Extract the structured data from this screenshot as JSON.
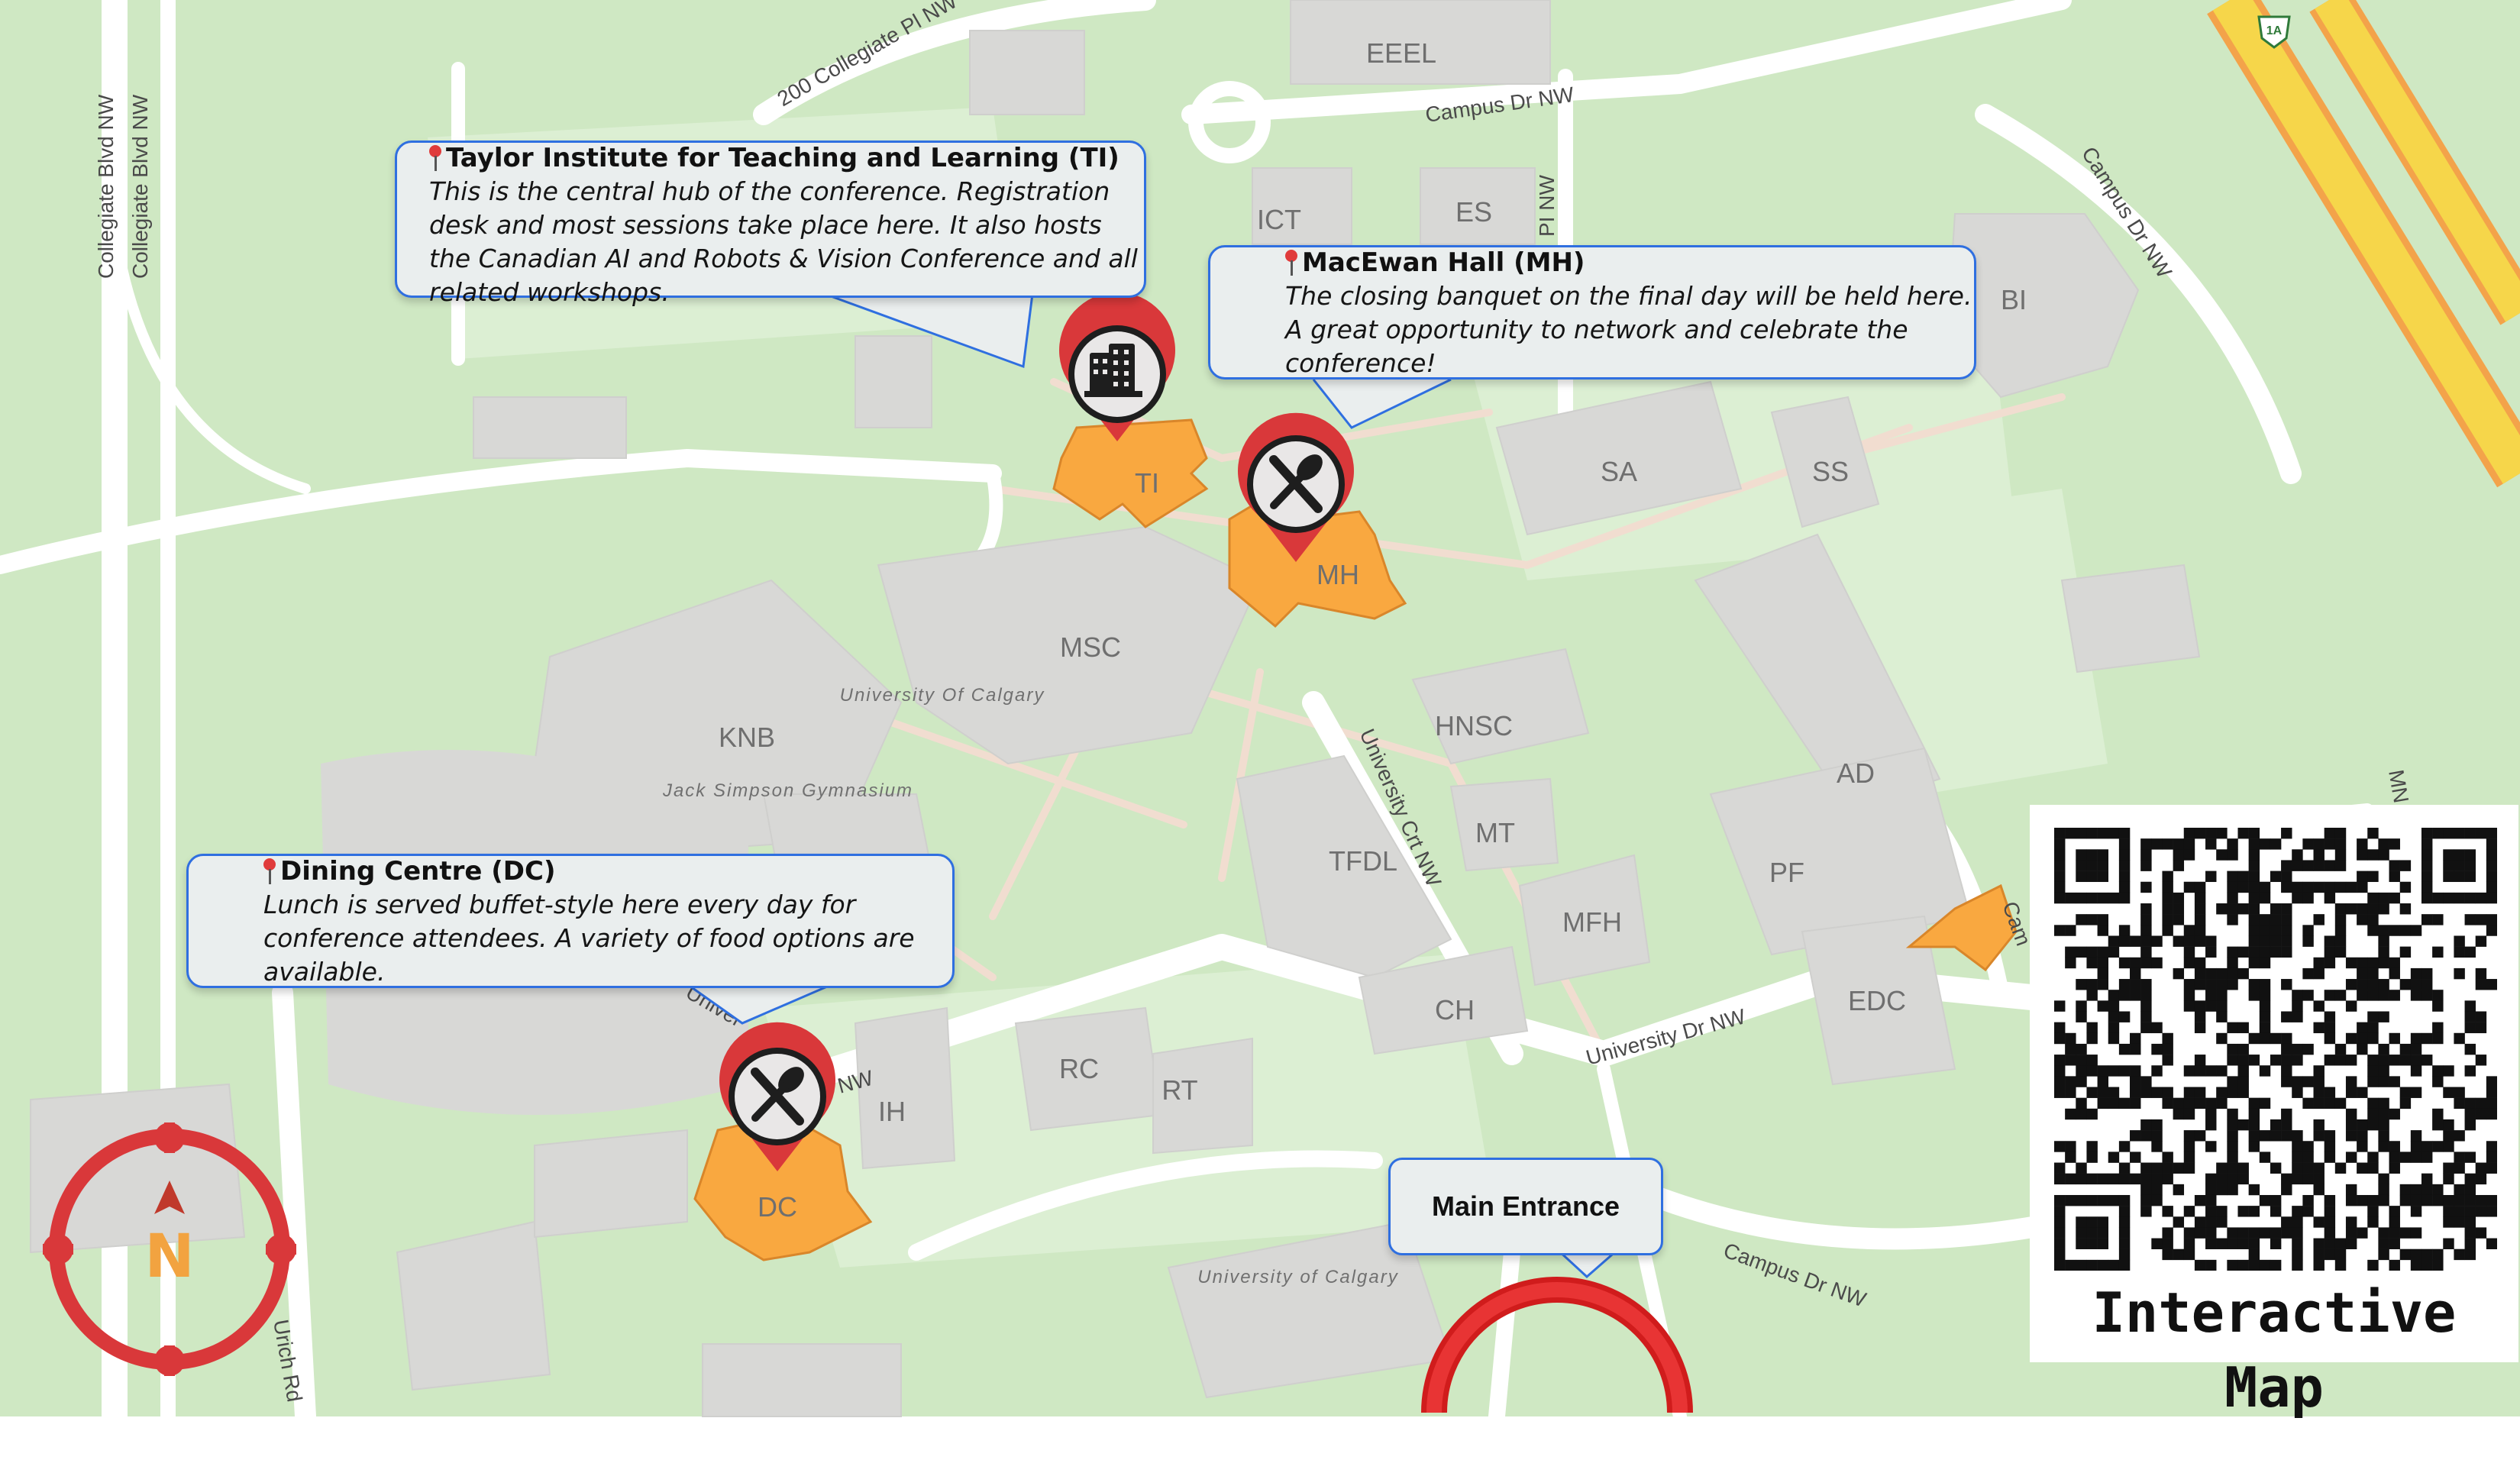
{
  "map": {
    "buildings": [
      "EEEL",
      "ICT",
      "ES",
      "BI",
      "TI",
      "MH",
      "SA",
      "SS",
      "MSC",
      "KNB",
      "HNSC",
      "AD",
      "MT",
      "TFDL",
      "PF",
      "MFH",
      "CH",
      "EDC",
      "RC",
      "RT",
      "IH",
      "DC"
    ],
    "place_labels": {
      "campus": "University Of Calgary",
      "gym": "Jack Simpson Gymnasium",
      "campus_south": "University of Calgary"
    },
    "streets": {
      "collegiate_pl": "200 Collegiate Pl NW",
      "collegiate_blvd": "Collegiate Blvd NW",
      "campus_dr_north": "Campus Dr NW",
      "campus_dr_east": "Campus Dr NW",
      "pi_nw": "PI NW",
      "university_crt": "University Crt NW",
      "university_dr": "University Dr NW",
      "campus_dr_south": "Campus Dr NW",
      "urich_rd": "Urich Rd",
      "univ_frag": "Univer",
      "nw_frag": "NW",
      "cam_frag": "Cam",
      "mn_frag": "MN",
      "highway": "1A"
    },
    "colors": {
      "park": "#cfe8c3",
      "building": "#d8d8d6",
      "highlight": "#f9a840",
      "pin": "#d9383a",
      "callout_border": "#2f6fe0",
      "compass": "#d9383a"
    }
  },
  "callouts": {
    "ti": {
      "title": "Taylor Institute for Teaching and Learning (TI)",
      "body": "This is the central hub of the conference. Registration desk and most sessions take place here. It also hosts the Canadian AI and Robots & Vision Conference and all related workshops."
    },
    "mh": {
      "title": "MacEwan Hall (MH)",
      "body": "The closing banquet on the final day will be held here. A great opportunity to network and celebrate the conference!"
    },
    "dc": {
      "title": "Dining Centre (DC)",
      "body": "Lunch is served buffet-style here every day for conference attendees. A variety of food options are available."
    }
  },
  "markers": {
    "ti": "building-icon",
    "mh": "utensils-icon",
    "dc": "utensils-icon"
  },
  "entrance": {
    "label": "Main Entrance"
  },
  "compass": {
    "letter": "N"
  },
  "qr": {
    "title": "Interactive Map"
  }
}
